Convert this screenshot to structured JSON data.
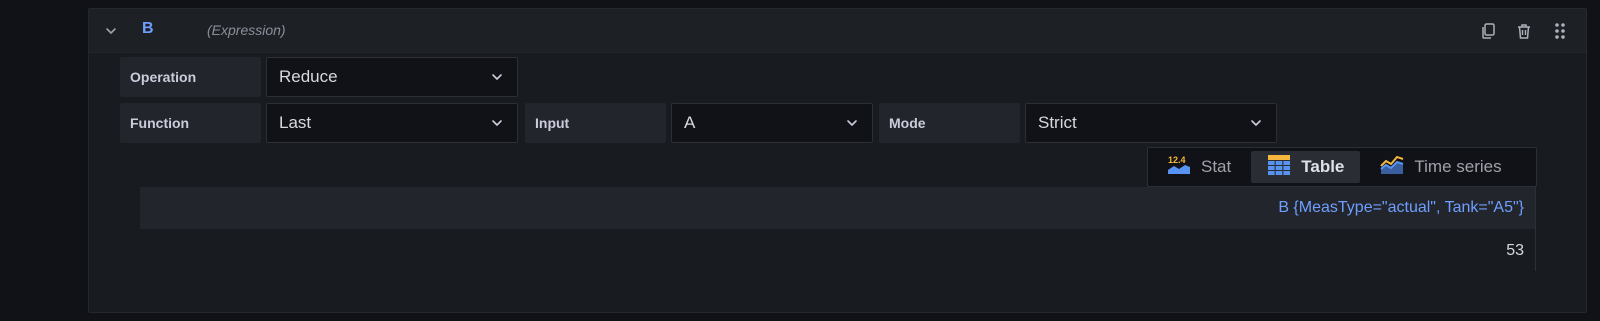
{
  "query": {
    "name": "B",
    "type_label": "(Expression)"
  },
  "header_actions": {
    "icons": [
      "duplicate-icon",
      "trash-icon",
      "drag-handle-icon"
    ]
  },
  "fields": {
    "operation": {
      "label": "Operation",
      "value": "Reduce"
    },
    "function": {
      "label": "Function",
      "value": "Last"
    },
    "input": {
      "label": "Input",
      "value": "A"
    },
    "mode": {
      "label": "Mode",
      "value": "Strict"
    }
  },
  "view_toggle": {
    "options": [
      {
        "label": "Stat",
        "icon": "stat-icon",
        "icon_text": "12.4",
        "active": false
      },
      {
        "label": "Table",
        "icon": "table-icon",
        "active": true
      },
      {
        "label": "Time series",
        "icon": "time-series-icon",
        "active": false
      }
    ]
  },
  "table": {
    "column_header": "B {MeasType=\"actual\", Tank=\"A5\"}",
    "rows": [
      [
        "53"
      ]
    ]
  },
  "colors": {
    "accent": "#6e9fff",
    "background": "#111217",
    "card": "#181b1f",
    "header": "#1d2025",
    "label_bg": "#22252b"
  }
}
